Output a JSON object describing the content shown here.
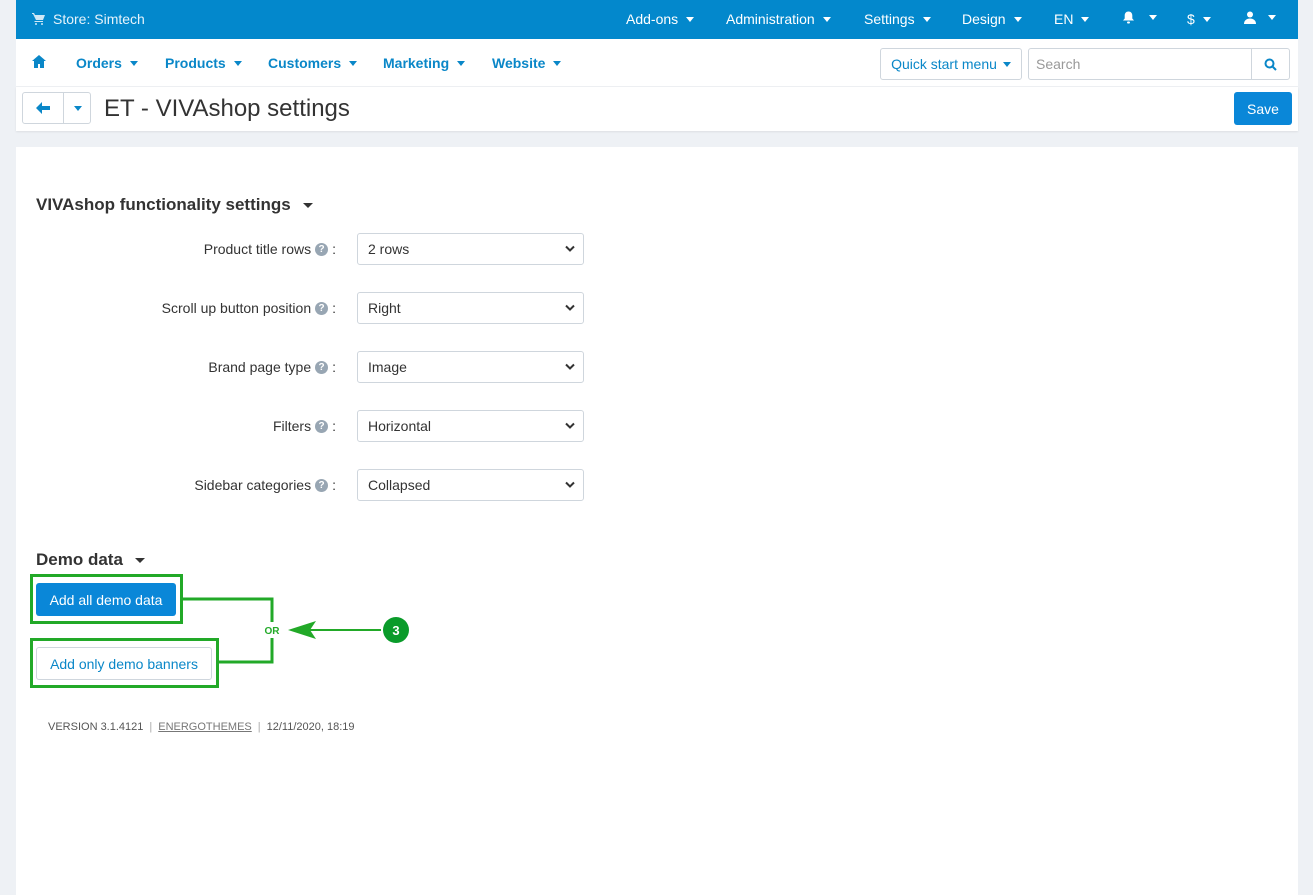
{
  "topbar": {
    "store_label": "Store: Simtech",
    "menu": [
      {
        "label": "Add-ons"
      },
      {
        "label": "Administration"
      },
      {
        "label": "Settings"
      },
      {
        "label": "Design"
      },
      {
        "label": "EN"
      },
      {
        "label": "$"
      }
    ],
    "bg_color": "#0388cc"
  },
  "mainnav": {
    "items": [
      {
        "label": "Orders"
      },
      {
        "label": "Products"
      },
      {
        "label": "Customers"
      },
      {
        "label": "Marketing"
      },
      {
        "label": "Website"
      }
    ],
    "quick_start_label": "Quick start menu",
    "search_placeholder": "Search"
  },
  "titlebar": {
    "title": "ET - VIVAshop settings",
    "save_label": "Save"
  },
  "functionality": {
    "section_title": "VIVAshop functionality settings",
    "settings": [
      {
        "label": "Product title rows",
        "value": "2 rows"
      },
      {
        "label": "Scroll up button position",
        "value": "Right"
      },
      {
        "label": "Brand page type",
        "value": "Image"
      },
      {
        "label": "Filters",
        "value": "Horizontal"
      },
      {
        "label": "Sidebar categories",
        "value": "Collapsed"
      }
    ]
  },
  "demo": {
    "section_title": "Demo data",
    "add_all_label": "Add all demo data",
    "add_banners_label": "Add only demo banners"
  },
  "annotation": {
    "or_label": "OR",
    "step_number": "3",
    "color": "#22a928"
  },
  "footer": {
    "version": "VERSION 3.1.4121",
    "brand": "ENERGOTHEMES",
    "date": "12/11/2020, 18:19"
  }
}
